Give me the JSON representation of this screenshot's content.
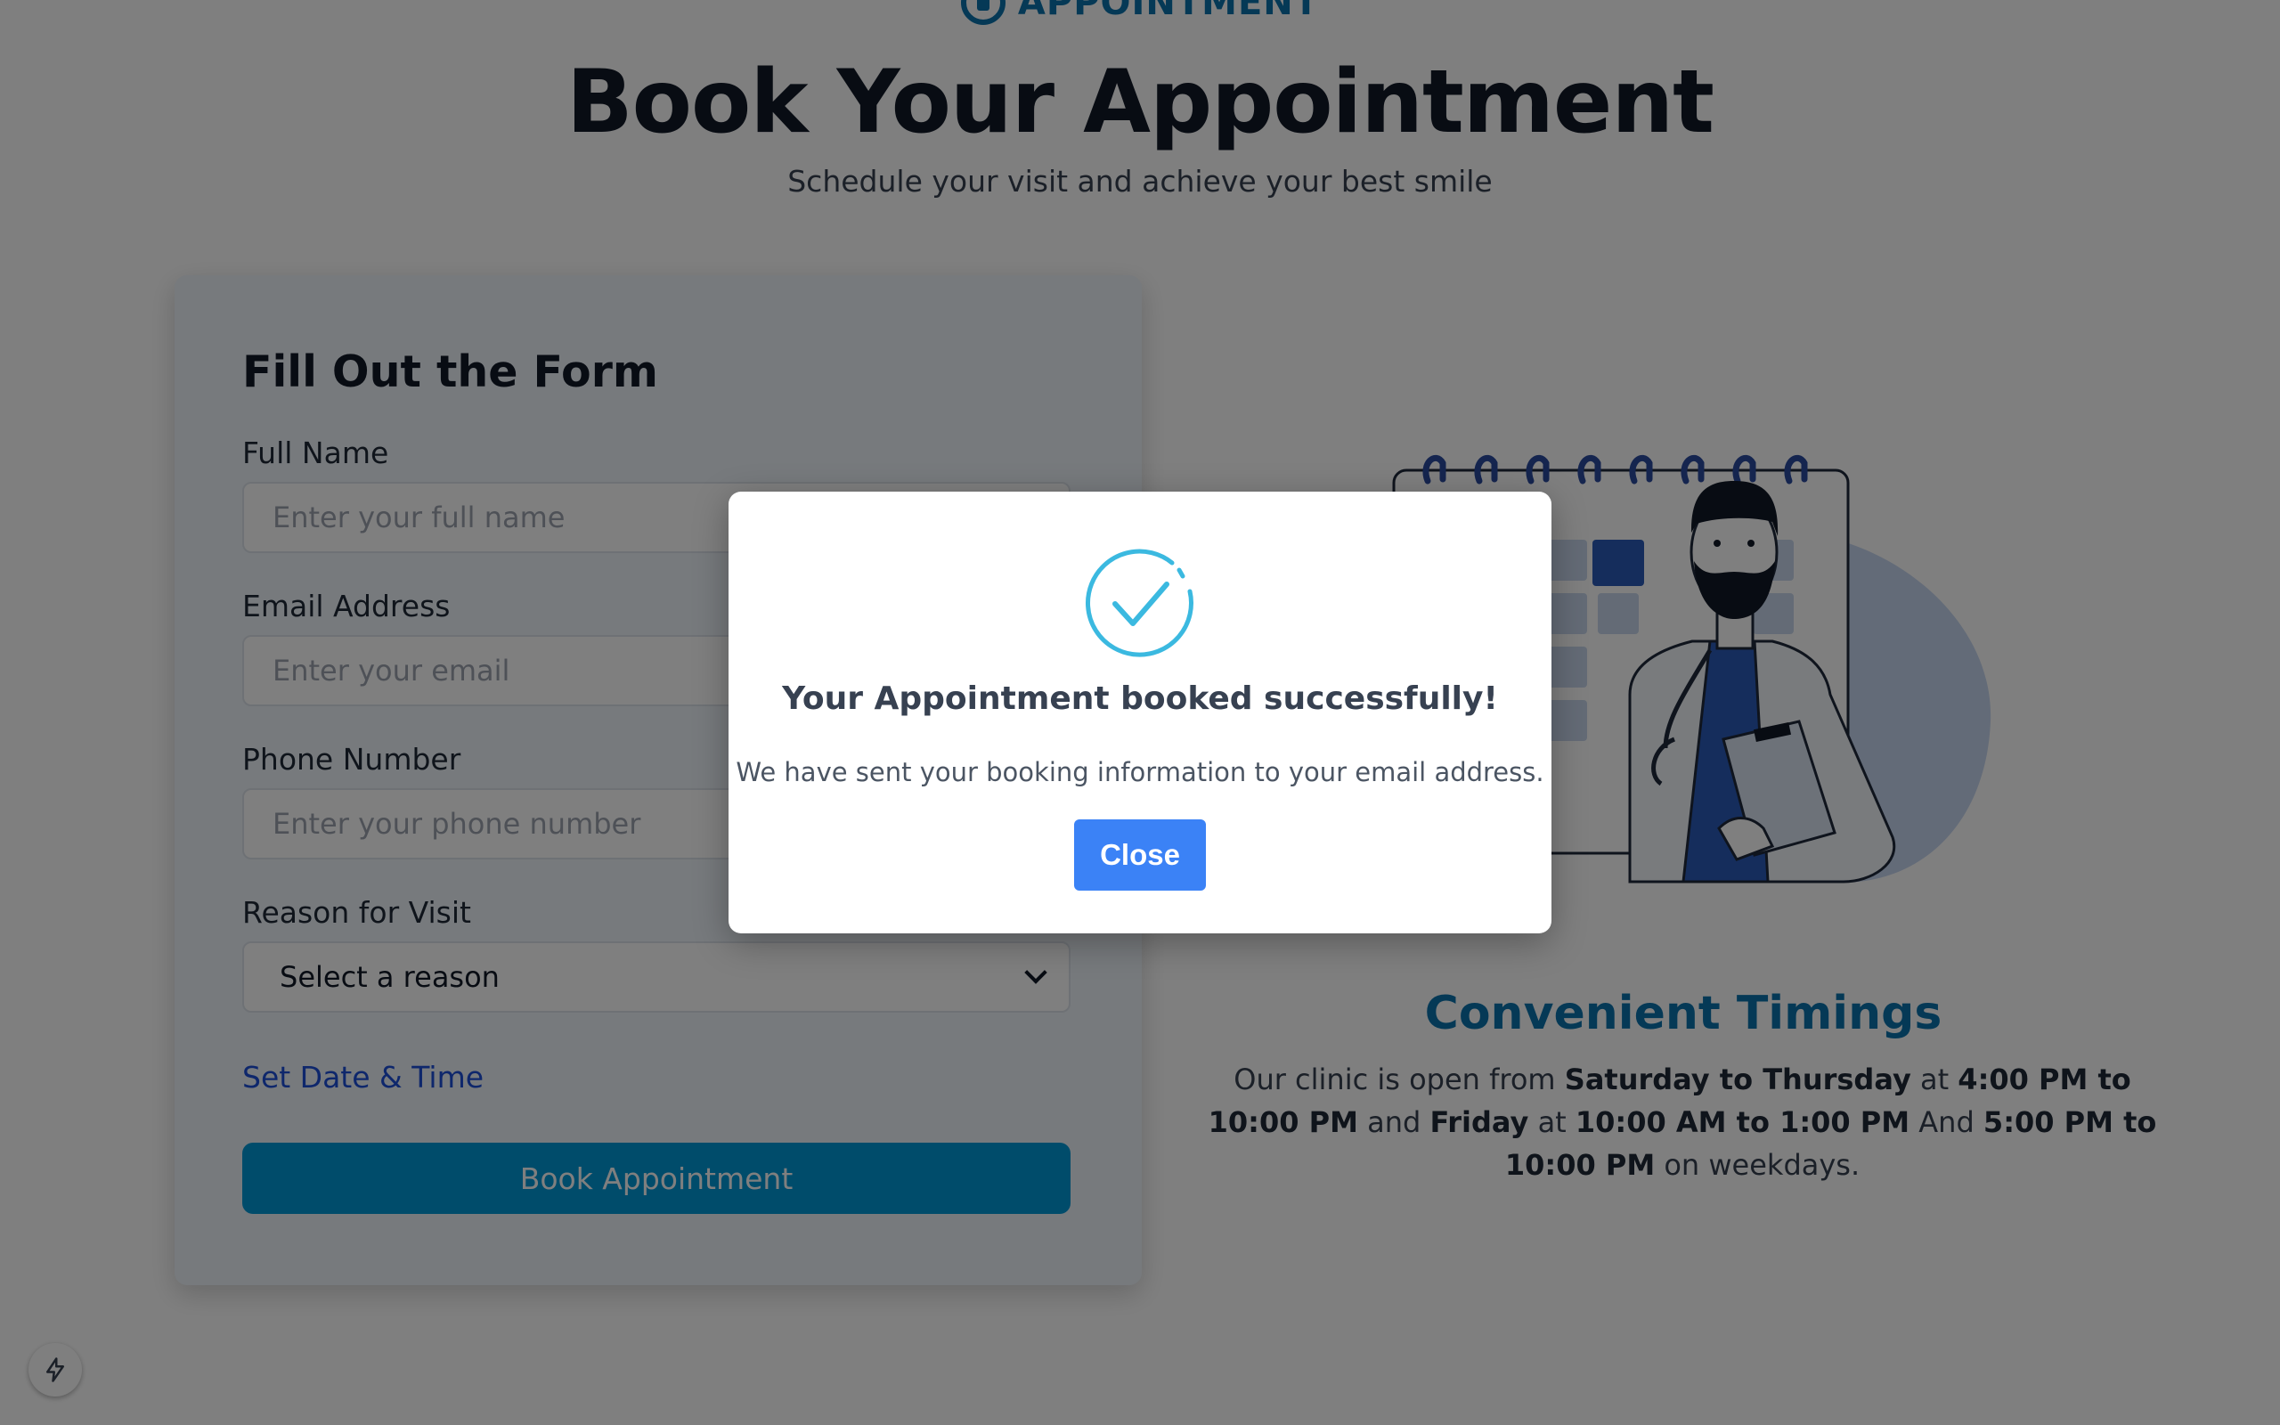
{
  "header": {
    "eyebrow": "APPOINTMENT",
    "title": "Book Your Appointment",
    "subtitle": "Schedule your visit and achieve your best smile"
  },
  "form": {
    "title": "Fill Out the Form",
    "full_name": {
      "label": "Full Name",
      "placeholder": "Enter your full name"
    },
    "email": {
      "label": "Email Address",
      "placeholder": "Enter your email"
    },
    "phone": {
      "label": "Phone Number",
      "placeholder": "Enter your phone number"
    },
    "reason": {
      "label": "Reason for Visit",
      "selected": "Select a reason"
    },
    "set_date_label": "Set Date & Time",
    "submit_label": "Book Appointment"
  },
  "timings": {
    "title": "Convenient Timings",
    "t1": "Our clinic is open from ",
    "days1": "Saturday to Thursday",
    "t2": " at ",
    "hours1": "4:00 PM to 10:00 PM",
    "t3": " and ",
    "day2": "Friday",
    "t4": " at ",
    "hours2": "10:00 AM to 1:00 PM",
    "t5": " And ",
    "hours3": "5:00 PM to 10:00 PM",
    "t6": " on weekdays."
  },
  "modal": {
    "title": "Your Appointment booked successfully!",
    "message": "We have sent your booking information to your email address.",
    "close_label": "Close"
  },
  "colors": {
    "brand": "#0b73ad",
    "primary_button": "#0098d6",
    "close_button": "#3b82f6",
    "success_check": "#3bb9e0",
    "link": "#1d4ed8"
  },
  "icons": [
    "tooth-icon",
    "success-check-icon",
    "chevron-down-icon",
    "lightning-icon"
  ]
}
